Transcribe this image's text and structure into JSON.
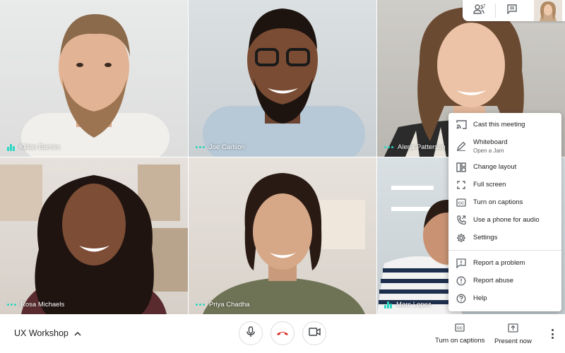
{
  "participants": [
    {
      "id": "t1",
      "name": "Killian Barnes",
      "speaking": "bars"
    },
    {
      "id": "t2",
      "name": "Joe Carlson",
      "speaking": "dots"
    },
    {
      "id": "t3",
      "name": "Alena Patterson",
      "speaking": "dots"
    },
    {
      "id": "t4",
      "name": "Rosa Michaels",
      "speaking": "dots"
    },
    {
      "id": "t5",
      "name": "Priya Chadha",
      "speaking": "dots"
    },
    {
      "id": "t6",
      "name": "Marc Lopez",
      "speaking": "bars"
    }
  ],
  "top_chip": {
    "participant_count": "7",
    "people_icon": "people-icon",
    "chat_icon": "chat-icon"
  },
  "menu": {
    "items": [
      {
        "label": "Cast this meeting",
        "icon": "cast-icon"
      },
      {
        "label": "Whiteboard",
        "sub": "Open a Jam",
        "icon": "pencil-icon"
      },
      {
        "label": "Change layout",
        "icon": "layout-icon"
      },
      {
        "label": "Full screen",
        "icon": "fullscreen-icon"
      },
      {
        "label": "Turn on captions",
        "icon": "captions-icon"
      },
      {
        "label": "Use a phone for audio",
        "icon": "phone-icon"
      },
      {
        "label": "Settings",
        "icon": "gear-icon"
      },
      {
        "label": "Report a problem",
        "icon": "report-problem-icon"
      },
      {
        "label": "Report abuse",
        "icon": "report-abuse-icon"
      },
      {
        "label": "Help",
        "icon": "help-icon"
      }
    ]
  },
  "bottom_bar": {
    "meeting_title": "UX Workshop",
    "captions_label": "Turn on captions",
    "present_label": "Present now"
  },
  "colors": {
    "speaking_indicator": "#2bd6c2",
    "hangup": "#d93025",
    "text": "#202124",
    "icon": "#5f6368"
  }
}
